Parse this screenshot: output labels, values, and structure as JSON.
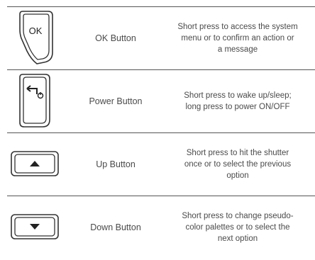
{
  "rows": [
    {
      "icon": "ok-button-icon",
      "icon_text": "OK",
      "name": "OK Button",
      "desc_lines": [
        "Short press to access the system",
        "menu or to confirm an action or",
        "a message"
      ]
    },
    {
      "icon": "power-button-icon",
      "name": "Power Button",
      "desc_lines": [
        "Short press to wake up/sleep;",
        "long press to power ON/OFF"
      ]
    },
    {
      "icon": "up-button-icon",
      "name": "Up Button",
      "desc_lines": [
        "Short press to hit the shutter",
        "once or to select the previous",
        "option"
      ]
    },
    {
      "icon": "down-button-icon",
      "name": "Down Button",
      "desc_lines": [
        "Short press to change pseudo-",
        "color palettes or to select the",
        "next option"
      ]
    }
  ]
}
